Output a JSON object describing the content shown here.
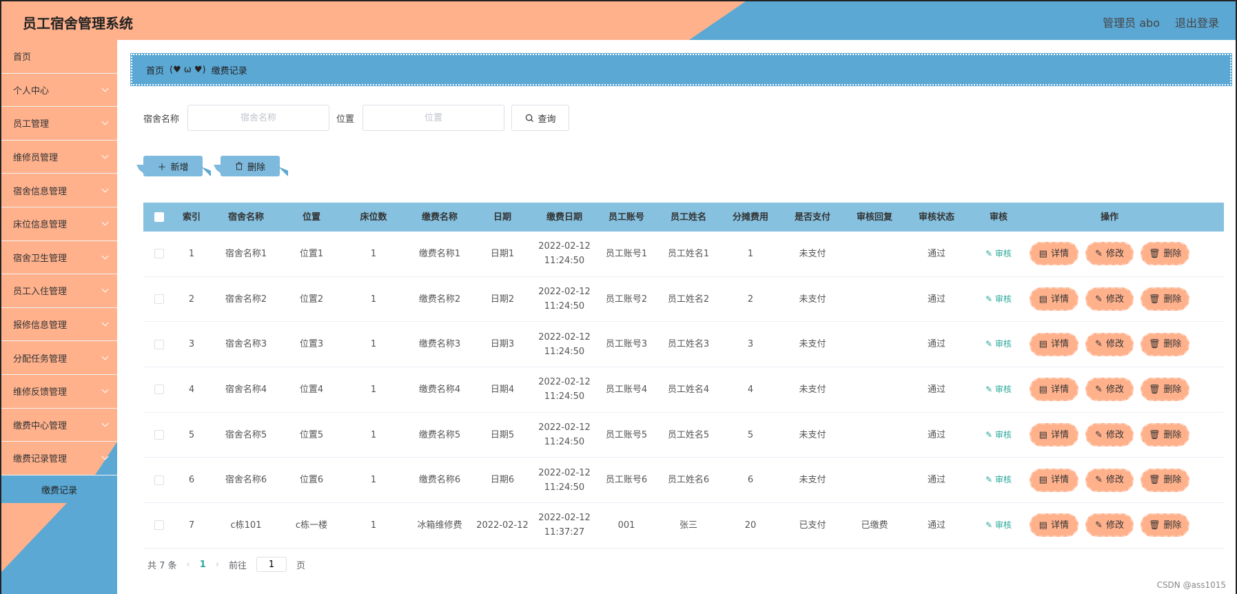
{
  "header": {
    "title": "员工宿舍管理系统",
    "user_label": "管理员 abo",
    "logout_label": "退出登录"
  },
  "sidebar": {
    "items": [
      {
        "label": "首页",
        "chevron": false
      },
      {
        "label": "个人中心",
        "chevron": true
      },
      {
        "label": "员工管理",
        "chevron": true
      },
      {
        "label": "维修员管理",
        "chevron": true
      },
      {
        "label": "宿舍信息管理",
        "chevron": true
      },
      {
        "label": "床位信息管理",
        "chevron": true
      },
      {
        "label": "宿舍卫生管理",
        "chevron": true
      },
      {
        "label": "员工入住管理",
        "chevron": true
      },
      {
        "label": "报修信息管理",
        "chevron": true
      },
      {
        "label": "分配任务管理",
        "chevron": true
      },
      {
        "label": "维修反馈管理",
        "chevron": true
      },
      {
        "label": "缴费中心管理",
        "chevron": true
      },
      {
        "label": "缴费记录管理",
        "chevron": true
      }
    ],
    "sub_item": "缴费记录"
  },
  "breadcrumb": {
    "home": "首页",
    "separator": "(♥ ω ♥)",
    "current": "缴费记录"
  },
  "search": {
    "name_label": "宿舍名称",
    "name_placeholder": "宿舍名称",
    "pos_label": "位置",
    "pos_placeholder": "位置",
    "query_label": "查询"
  },
  "actions": {
    "add_label": "新增",
    "delete_label": "删除"
  },
  "table": {
    "headers": [
      "索引",
      "宿舍名称",
      "位置",
      "床位数",
      "缴费名称",
      "日期",
      "缴费日期",
      "员工账号",
      "员工姓名",
      "分摊费用",
      "是否支付",
      "审核回复",
      "审核状态",
      "审核",
      "操作"
    ],
    "audit_label": "审核",
    "op_detail": "详情",
    "op_edit": "修改",
    "op_delete": "删除",
    "rows": [
      {
        "idx": "1",
        "name": "宿舍名称1",
        "pos": "位置1",
        "beds": "1",
        "fee": "缴费名称1",
        "date": "日期1",
        "paydate": "2022-02-12 11:24:50",
        "acc": "员工账号1",
        "ename": "员工姓名1",
        "share": "1",
        "paid": "未支付",
        "reply": "",
        "status": "通过"
      },
      {
        "idx": "2",
        "name": "宿舍名称2",
        "pos": "位置2",
        "beds": "1",
        "fee": "缴费名称2",
        "date": "日期2",
        "paydate": "2022-02-12 11:24:50",
        "acc": "员工账号2",
        "ename": "员工姓名2",
        "share": "2",
        "paid": "未支付",
        "reply": "",
        "status": "通过"
      },
      {
        "idx": "3",
        "name": "宿舍名称3",
        "pos": "位置3",
        "beds": "1",
        "fee": "缴费名称3",
        "date": "日期3",
        "paydate": "2022-02-12 11:24:50",
        "acc": "员工账号3",
        "ename": "员工姓名3",
        "share": "3",
        "paid": "未支付",
        "reply": "",
        "status": "通过"
      },
      {
        "idx": "4",
        "name": "宿舍名称4",
        "pos": "位置4",
        "beds": "1",
        "fee": "缴费名称4",
        "date": "日期4",
        "paydate": "2022-02-12 11:24:50",
        "acc": "员工账号4",
        "ename": "员工姓名4",
        "share": "4",
        "paid": "未支付",
        "reply": "",
        "status": "通过"
      },
      {
        "idx": "5",
        "name": "宿舍名称5",
        "pos": "位置5",
        "beds": "1",
        "fee": "缴费名称5",
        "date": "日期5",
        "paydate": "2022-02-12 11:24:50",
        "acc": "员工账号5",
        "ename": "员工姓名5",
        "share": "5",
        "paid": "未支付",
        "reply": "",
        "status": "通过"
      },
      {
        "idx": "6",
        "name": "宿舍名称6",
        "pos": "位置6",
        "beds": "1",
        "fee": "缴费名称6",
        "date": "日期6",
        "paydate": "2022-02-12 11:24:50",
        "acc": "员工账号6",
        "ename": "员工姓名6",
        "share": "6",
        "paid": "未支付",
        "reply": "",
        "status": "通过"
      },
      {
        "idx": "7",
        "name": "c栋101",
        "pos": "c栋一楼",
        "beds": "1",
        "fee": "冰箱维修费",
        "date": "2022-02-12",
        "paydate": "2022-02-12 11:37:27",
        "acc": "001",
        "ename": "张三",
        "share": "20",
        "paid": "已支付",
        "reply": "已缴费",
        "status": "通过"
      }
    ]
  },
  "pager": {
    "total": "共 7 条",
    "page": "1",
    "goto_prefix": "前往",
    "goto_value": "1",
    "goto_suffix": "页"
  },
  "watermark": "CSDN @ass1015",
  "colors": {
    "peach": "#ffb18c",
    "blue": "#5ba8d4",
    "table_header": "#86c1e0",
    "link": "#2aa89b"
  }
}
